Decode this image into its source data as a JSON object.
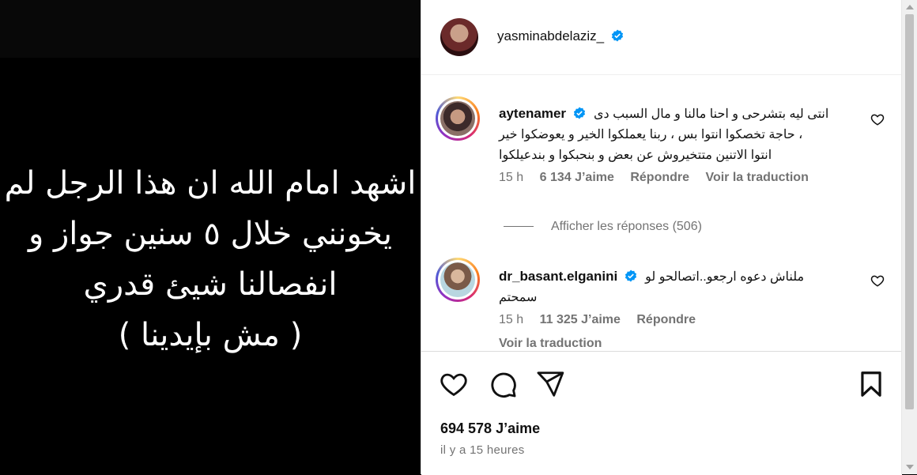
{
  "media": {
    "lines": [
      "اشهد امام الله ان هذا الرجل لم",
      "يخونني خلال ٥ سنين جواز و",
      "انفصالنا شيئ قدري",
      "( مش بإيدينا )"
    ]
  },
  "post": {
    "username": "yasminabdelaziz_",
    "likes": "694 578 J’aime",
    "posted": "il y a 15 heures"
  },
  "comments": [
    {
      "user": "aytenamer",
      "text_lines": [
        "انتى ليه بتشرحى و احنا مالنا و مال السبب دى",
        "حاجة تخصكوا انتوا بس ، ربنا يعملكوا الخير و يعوضكوا خير ،",
        "انتوا الاتنين متتخيروش عن بعض و بنحبكوا و بندعيلكوا"
      ],
      "time": "15 h",
      "likes": "6 134 J’aime",
      "reply": "Répondre",
      "translate": "Voir la traduction"
    },
    {
      "user": "dr_basant.elganini",
      "text_lines": [
        "ملناش دعوه ارجعو..اتصالحو لو",
        "سمحتم"
      ],
      "time": "15 h",
      "likes": "11 325 J’aime",
      "reply": "Répondre",
      "translate": "Voir la traduction"
    }
  ],
  "view_replies": "Afficher les réponses (506)",
  "colors": {
    "verified": "#0095f6",
    "muted": "#737373"
  }
}
